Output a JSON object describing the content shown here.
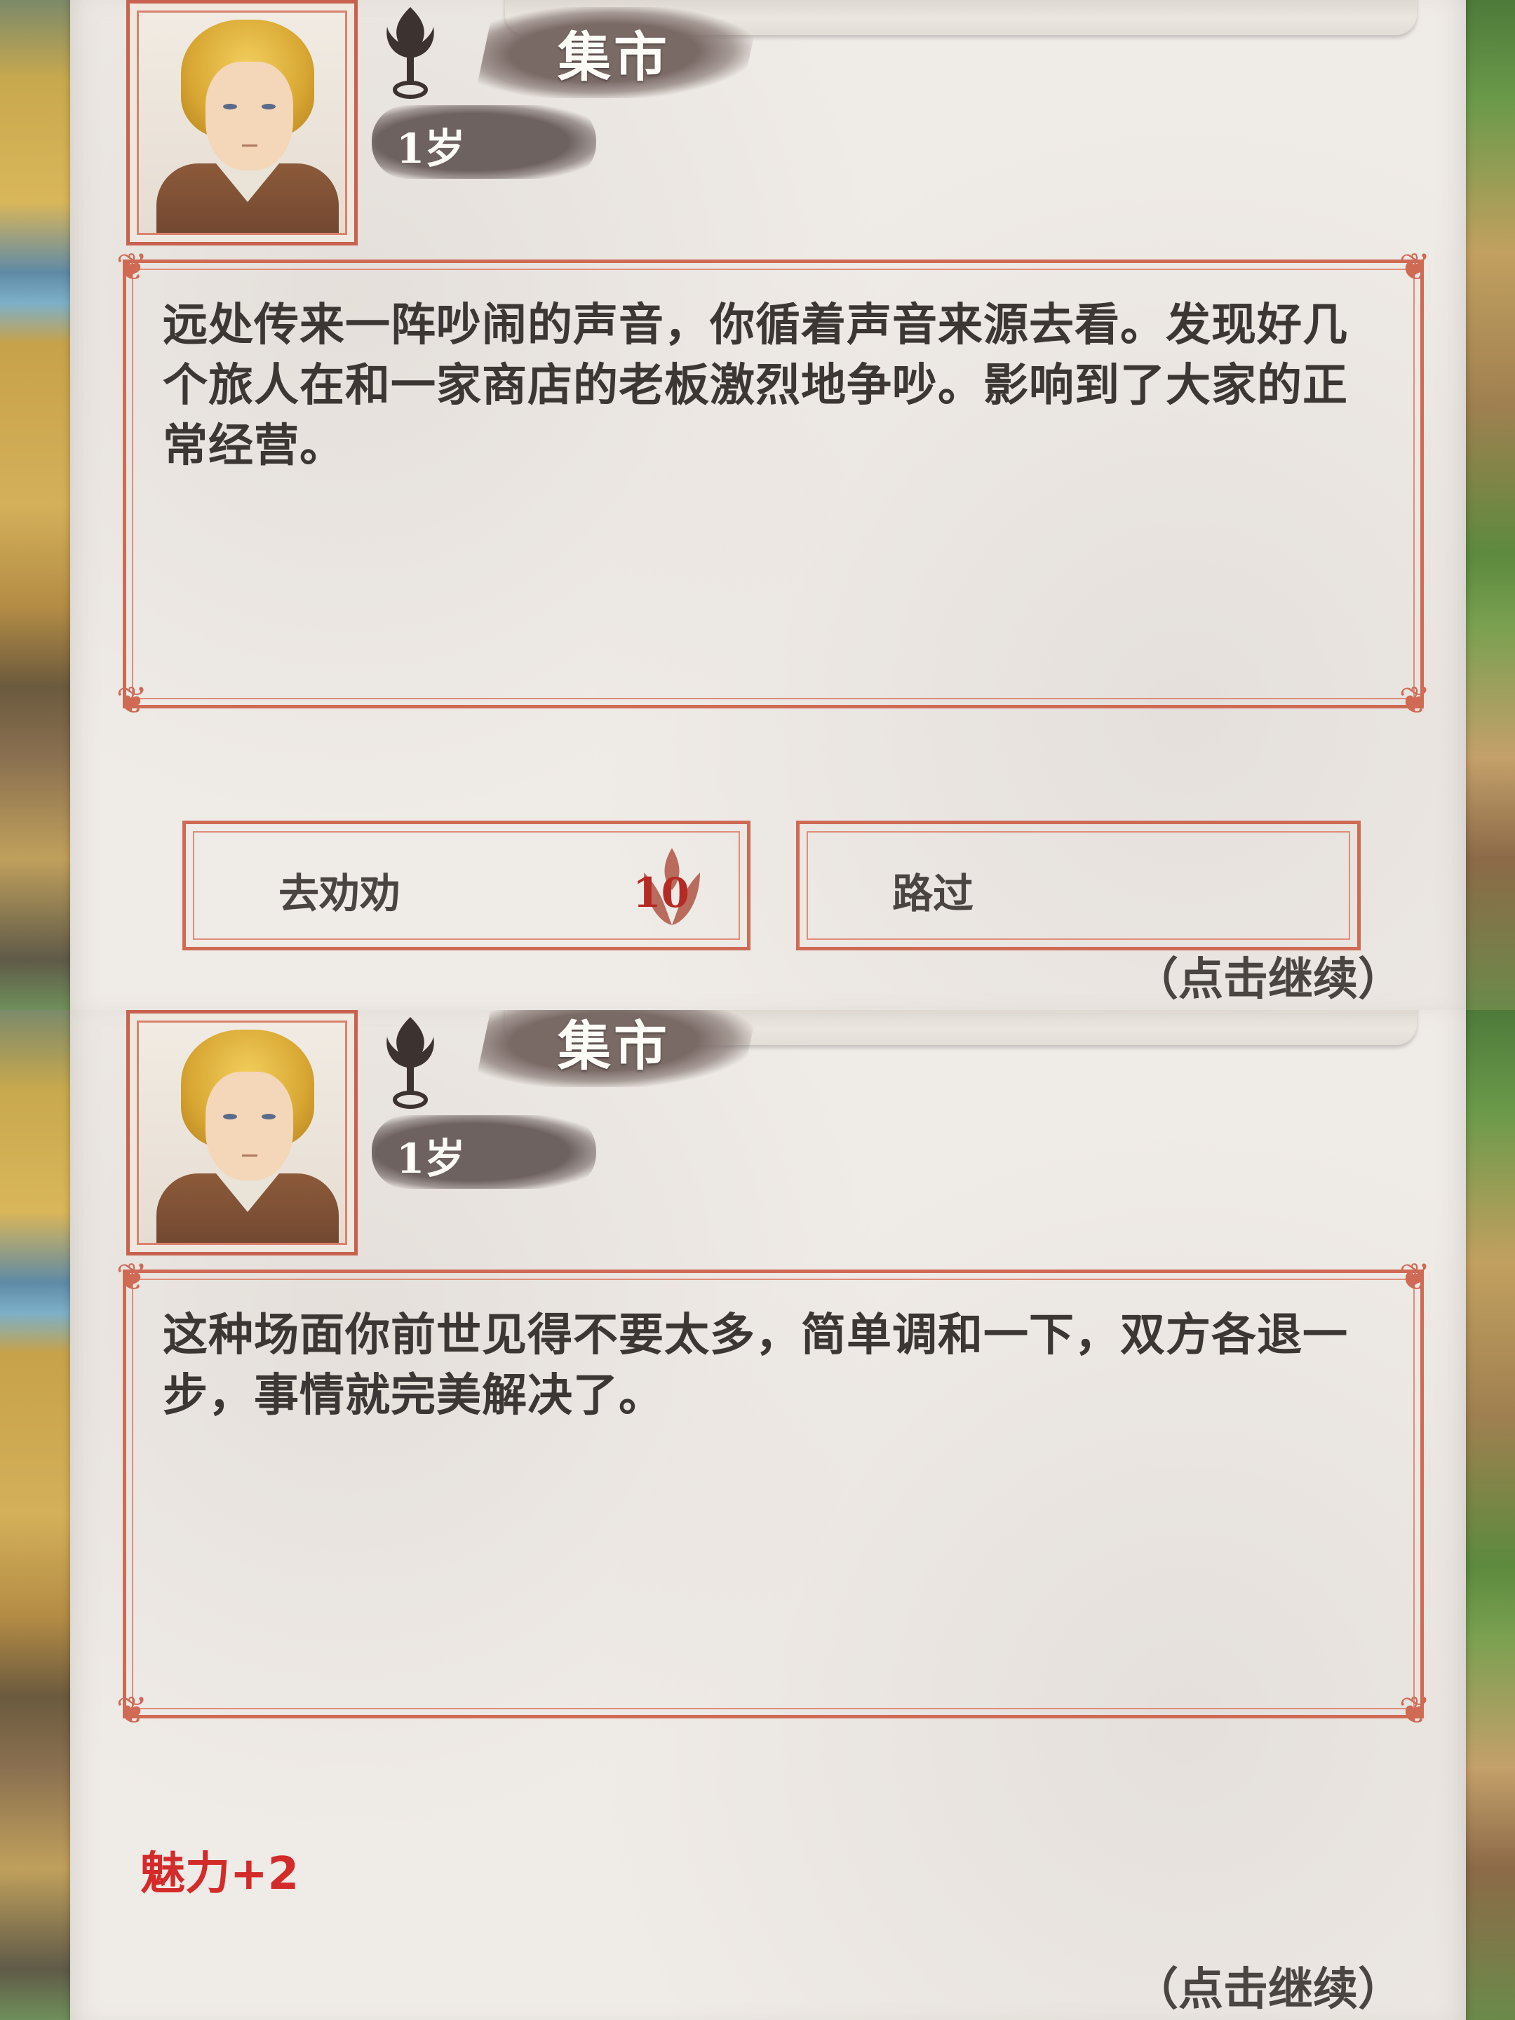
{
  "panels": [
    {
      "location": "集市",
      "age": "1岁",
      "story": "远处传来一阵吵闹的声音，你循着声音来源去看。发现好几个旅人在和一家商店的老板激烈地争吵。影响到了大家的正常经营。",
      "options": [
        {
          "label": "去劝劝",
          "cost": "10",
          "cost_icon": "petal-icon"
        },
        {
          "label": "路过"
        }
      ],
      "continue": "（点击继续）"
    },
    {
      "location": "集市",
      "age": "1岁",
      "story": "这种场面你前世见得不要太多，简单调和一下，双方各退一步，事情就完美解决了。",
      "reward": "魅力+2",
      "continue": "（点击继续）"
    }
  ],
  "colors": {
    "frame": "#cf6a55",
    "reward": "#d32a2a",
    "paper": "#efebe7",
    "text": "#3c3634"
  }
}
